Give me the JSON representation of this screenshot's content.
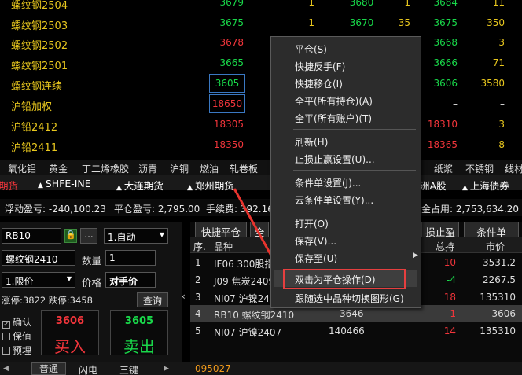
{
  "quotes": [
    {
      "name": "螺纹钢2504",
      "price": "3679",
      "c3": "1",
      "c4": "3680",
      "c5": "1",
      "c6": "3684",
      "c7": "11"
    },
    {
      "name": "螺纹钢2503",
      "price": "3675",
      "c3": "1",
      "c4": "3670",
      "c5": "35",
      "c6": "3675",
      "c7": "350"
    },
    {
      "name": "螺纹钢2502",
      "price": "3678",
      "c3": "1",
      "c4": "",
      "c5": "",
      "c6": "3668",
      "c7": "3"
    },
    {
      "name": "螺纹钢2501",
      "price": "3665",
      "c3": "",
      "c4": "",
      "c5": "",
      "c6": "3666",
      "c7": "71"
    },
    {
      "name": "螺纹钢连续",
      "price": "3605",
      "c3": "",
      "c4": "",
      "c5": "",
      "c6": "3606",
      "c7": "3580"
    },
    {
      "name": "沪铅加权",
      "price": "18650",
      "c3": "",
      "c4": "",
      "c5": "",
      "c6": "–",
      "c7": "–"
    },
    {
      "name": "沪铅2412",
      "price": "18305",
      "c3": "",
      "c4": "",
      "c5": "",
      "c6": "18310",
      "c7": "3"
    },
    {
      "name": "沪铅2411",
      "price": "18350",
      "c3": "",
      "c4": "",
      "c5": "",
      "c6": "18365",
      "c7": "8"
    }
  ],
  "categories": [
    "氧化铝",
    "黄金",
    "丁二烯橡胶",
    "沥青",
    "沪铜",
    "燃油",
    "轧卷板",
    "纸浆",
    "不锈钢",
    "线材"
  ],
  "exchanges": {
    "left_partial": "期货",
    "shfe_ine": "SHFE-INE",
    "dalian": "大连期货",
    "zhengzhou": "郑州期货",
    "partial_a": "洲A股",
    "shanghai_bond": "上海债券"
  },
  "account": {
    "float_pl": "浮动盈亏: -240,100.23",
    "close_pl": "平仓盈亏: 2,795.00",
    "fee": "手续费: 392.16",
    "margin": "金占用: 2,753,634.20"
  },
  "order": {
    "contract": "RB10",
    "contract_name": "螺纹钢2410",
    "mode": "1.自动",
    "qty_label": "数量",
    "qty": "1",
    "price_type": "1.限价",
    "price_label": "价格",
    "price_value": "对手价",
    "limits": "涨停:3822 跌停:3458",
    "query_btn": "查询",
    "confirm": "确认",
    "preserve": "保值",
    "embedded": "预埋",
    "buy_price": "3606",
    "buy_label": "买入",
    "sell_price": "3605",
    "sell_label": "卖出"
  },
  "positions": {
    "tabs": {
      "quick_close": "快捷平仓",
      "partial": "全",
      "stop": "损止盈",
      "cond": "条件单"
    },
    "headers": {
      "seq": "序.",
      "name": "品种",
      "total": "总持",
      "mkt": "市价"
    },
    "rows": [
      {
        "seq": "1",
        "name": "IF06 300股指",
        "total": "10",
        "mkt": "3531.2",
        "total_color": "#f2353b"
      },
      {
        "seq": "2",
        "name": "J09 焦炭2409",
        "total": "-4",
        "mkt": "2267.5",
        "total_color": "#19d84a"
      },
      {
        "seq": "3",
        "name": "NI07 沪镍240",
        "total": "18",
        "mkt": "135310",
        "total_color": "#f2353b"
      },
      {
        "seq": "4",
        "name": "RB10 螺纹钢2410",
        "mid": "3646",
        "total": "1",
        "mkt": "3606",
        "total_color": "#f2353b"
      },
      {
        "seq": "5",
        "name": "NI07 沪镍2407",
        "mid": "140466",
        "total": "14",
        "mkt": "135310",
        "total_color": "#f2353b"
      }
    ]
  },
  "bottom": {
    "tab_normal": "普通",
    "tab_flash": "闪电",
    "tab_three": "三键",
    "code": "095027"
  },
  "menu": {
    "close": "平仓(S)",
    "quick_reverse": "快捷反手(F)",
    "quick_move": "快捷移仓(I)",
    "close_all_pos": "全平(所有持仓)(A)",
    "close_all_acct": "全平(所有账户)(T)",
    "refresh": "刷新(H)",
    "stop_settings": "止损止赢设置(U)...",
    "cond_settings": "条件单设置(J)...",
    "cloud_cond": "云条件单设置(Y)...",
    "print": "打开(O)",
    "save": "保存(V)...",
    "save_to": "保存至(U)",
    "dblclick_close": "双击为平仓操作(D)",
    "follow_switch": "跟随选中品种切换图形(G)"
  }
}
